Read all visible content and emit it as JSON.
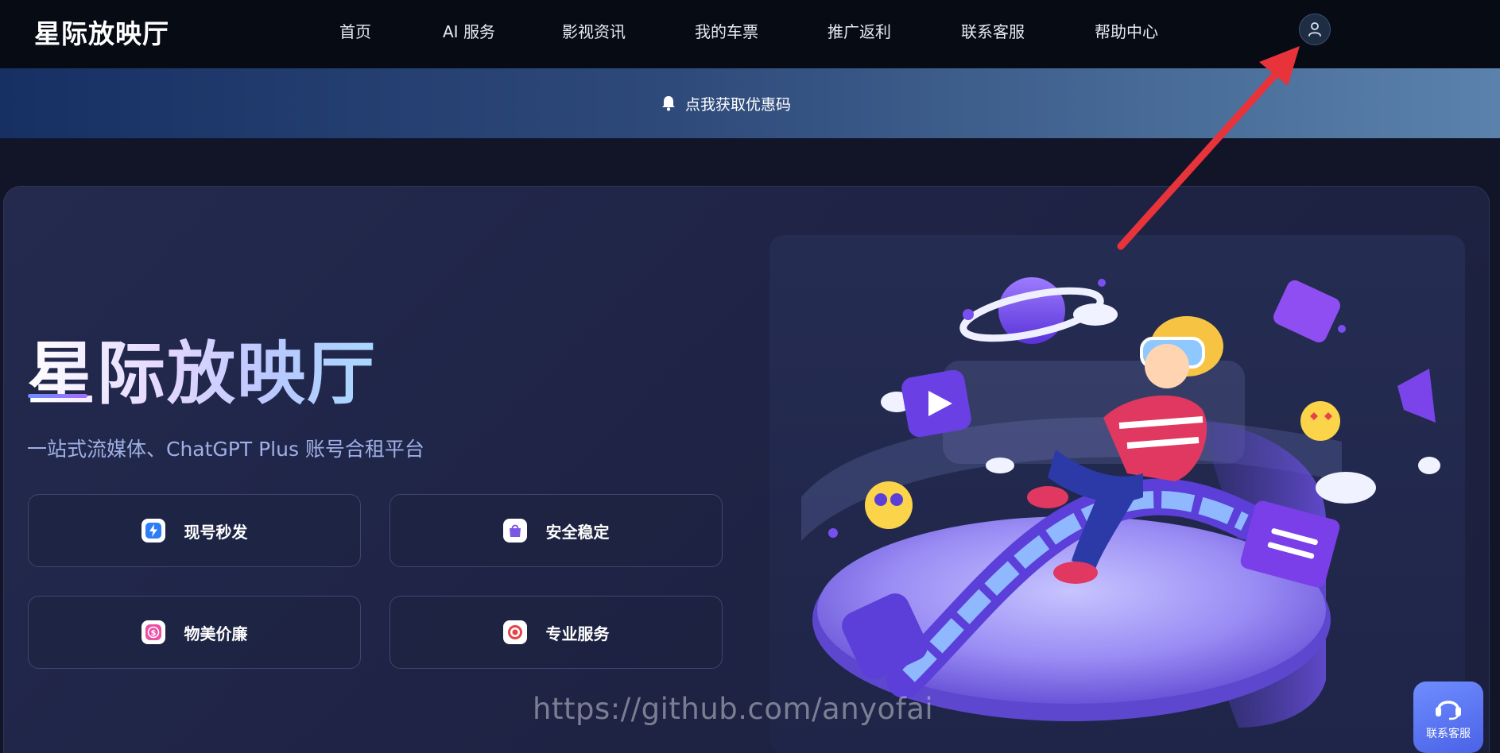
{
  "nav": {
    "logo": "星际放映厅",
    "links": [
      "首页",
      "AI 服务",
      "影视资讯",
      "我的车票",
      "推广返利",
      "联系客服",
      "帮助中心"
    ],
    "user_icon": "user-icon"
  },
  "banner": {
    "icon": "bell-icon",
    "text": "点我获取优惠码"
  },
  "hero": {
    "title": "星际放映厅",
    "subtitle": "一站式流媒体、ChatGPT Plus 账号合租平台",
    "features": [
      {
        "label": "现号秒发",
        "icon": "lightning-icon",
        "color": "#2f7df6"
      },
      {
        "label": "安全稳定",
        "icon": "bag-icon",
        "color": "#7b57e6"
      },
      {
        "label": "物美价廉",
        "icon": "dollar-icon",
        "color": "#ec4fa6"
      },
      {
        "label": "专业服务",
        "icon": "target-icon",
        "color": "#e5434b"
      }
    ]
  },
  "watermark": "https://github.com/anyofai",
  "floating_service": {
    "label": "联系客服",
    "icon": "headset-icon"
  },
  "colors": {
    "nav_bg": "#070b14",
    "page_bg": "#121528",
    "accent": "#6d8dff",
    "arrow": "#e8333b"
  }
}
